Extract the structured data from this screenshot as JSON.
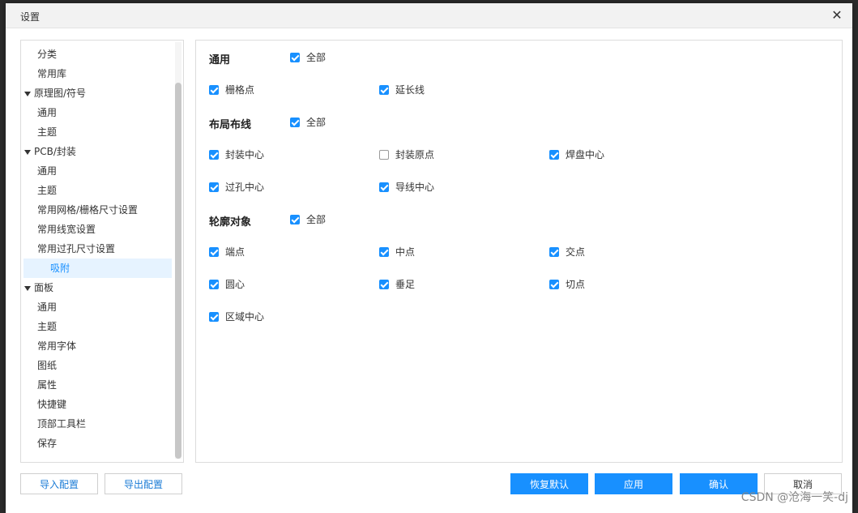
{
  "dialog": {
    "title": "设置",
    "close_icon": "close-icon"
  },
  "tree": {
    "items": [
      {
        "label": "分类",
        "level": 1
      },
      {
        "label": "常用库",
        "level": 1
      },
      {
        "label": "原理图/符号",
        "level": 0,
        "expanded": true
      },
      {
        "label": "通用",
        "level": 1
      },
      {
        "label": "主题",
        "level": 1
      },
      {
        "label": "PCB/封装",
        "level": 0,
        "expanded": true
      },
      {
        "label": "通用",
        "level": 1
      },
      {
        "label": "主题",
        "level": 1
      },
      {
        "label": "常用网格/栅格尺寸设置",
        "level": 1
      },
      {
        "label": "常用线宽设置",
        "level": 1
      },
      {
        "label": "常用过孔尺寸设置",
        "level": 1
      },
      {
        "label": "吸附",
        "level": 1,
        "selected": true
      },
      {
        "label": "面板",
        "level": 0,
        "expanded": true
      },
      {
        "label": "通用",
        "level": 1
      },
      {
        "label": "主题",
        "level": 1
      },
      {
        "label": "常用字体",
        "level": 0
      },
      {
        "label": "图纸",
        "level": 0
      },
      {
        "label": "属性",
        "level": 0
      },
      {
        "label": "快捷键",
        "level": 0
      },
      {
        "label": "顶部工具栏",
        "level": 0
      },
      {
        "label": "保存",
        "level": 0
      }
    ]
  },
  "groups": {
    "general": {
      "title": "通用",
      "all_label": "全部",
      "all_checked": true,
      "items": [
        {
          "label": "栅格点",
          "checked": true
        },
        {
          "label": "延长线",
          "checked": true
        }
      ]
    },
    "layout": {
      "title": "布局布线",
      "all_label": "全部",
      "all_checked": true,
      "items": [
        {
          "label": "封装中心",
          "checked": true
        },
        {
          "label": "封装原点",
          "checked": false
        },
        {
          "label": "焊盘中心",
          "checked": true
        },
        {
          "label": "过孔中心",
          "checked": true
        },
        {
          "label": "导线中心",
          "checked": true
        }
      ]
    },
    "outline": {
      "title": "轮廓对象",
      "all_label": "全部",
      "all_checked": true,
      "items": [
        {
          "label": "端点",
          "checked": true
        },
        {
          "label": "中点",
          "checked": true
        },
        {
          "label": "交点",
          "checked": true
        },
        {
          "label": "圆心",
          "checked": true
        },
        {
          "label": "垂足",
          "checked": true
        },
        {
          "label": "切点",
          "checked": true
        },
        {
          "label": "区域中心",
          "checked": true
        }
      ]
    }
  },
  "buttons": {
    "import": "导入配置",
    "export": "导出配置",
    "restore": "恢复默认",
    "apply": "应用",
    "ok": "确认",
    "cancel": "取消"
  },
  "watermark": "CSDN @沧海一笑-dj",
  "colors": {
    "accent": "#1890ff",
    "selected_bg": "#e6f3ff"
  }
}
